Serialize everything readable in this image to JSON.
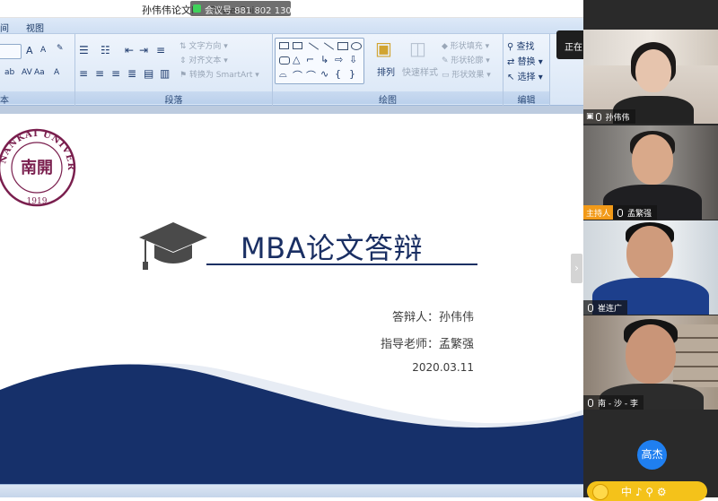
{
  "window": {
    "title": "孙伟伟论文P　 PowerPoint",
    "meeting_overlay": "会议号 881 802 130",
    "minimize": "—",
    "restore": "❐",
    "close": "✕"
  },
  "menu": [
    "间",
    "视图"
  ],
  "ribbon": {
    "font_group_label": "本",
    "paragraph_group_label": "段落",
    "paragraph_items": [
      "文字方向",
      "对齐文本",
      "转换为 SmartArt"
    ],
    "drawing_group_label": "绘图",
    "arrange_label": "排列",
    "quick_styles_label": "快速样式",
    "shape_items": [
      "形状填充",
      "形状轮廓",
      "形状效果"
    ],
    "edit_group_label": "编辑",
    "edit_items": [
      "查找",
      "替换",
      "选择"
    ]
  },
  "slide": {
    "seal_text": "NANKAI UNIVERSITY",
    "seal_year": "1919",
    "seal_center": "南開",
    "title": "MBA论文答辩",
    "defender_line": "答辩人：孙伟伟",
    "advisor_line": "指导老师：孟繁强",
    "date": "2020.03.11",
    "next_arrow": "›"
  },
  "meeting": {
    "sharing_label": "正在",
    "participants": [
      {
        "name": "孙伟伟",
        "host": false
      },
      {
        "name": "孟繁强",
        "host": true,
        "host_label": "主持人"
      },
      {
        "name": "崔连广",
        "host": false
      },
      {
        "name": "南 - 沙 - 李",
        "host": false
      }
    ],
    "avatar_name": "高杰",
    "reaction_icons": "中 ♪ ⚲ ⚙"
  },
  "colors": {
    "slide_navy": "#1a2f63",
    "seal_purple": "#7a1f4e",
    "host_badge": "#f29a18",
    "avatar_blue": "#1f7ff0",
    "reaction_yellow": "#f4c21a"
  }
}
